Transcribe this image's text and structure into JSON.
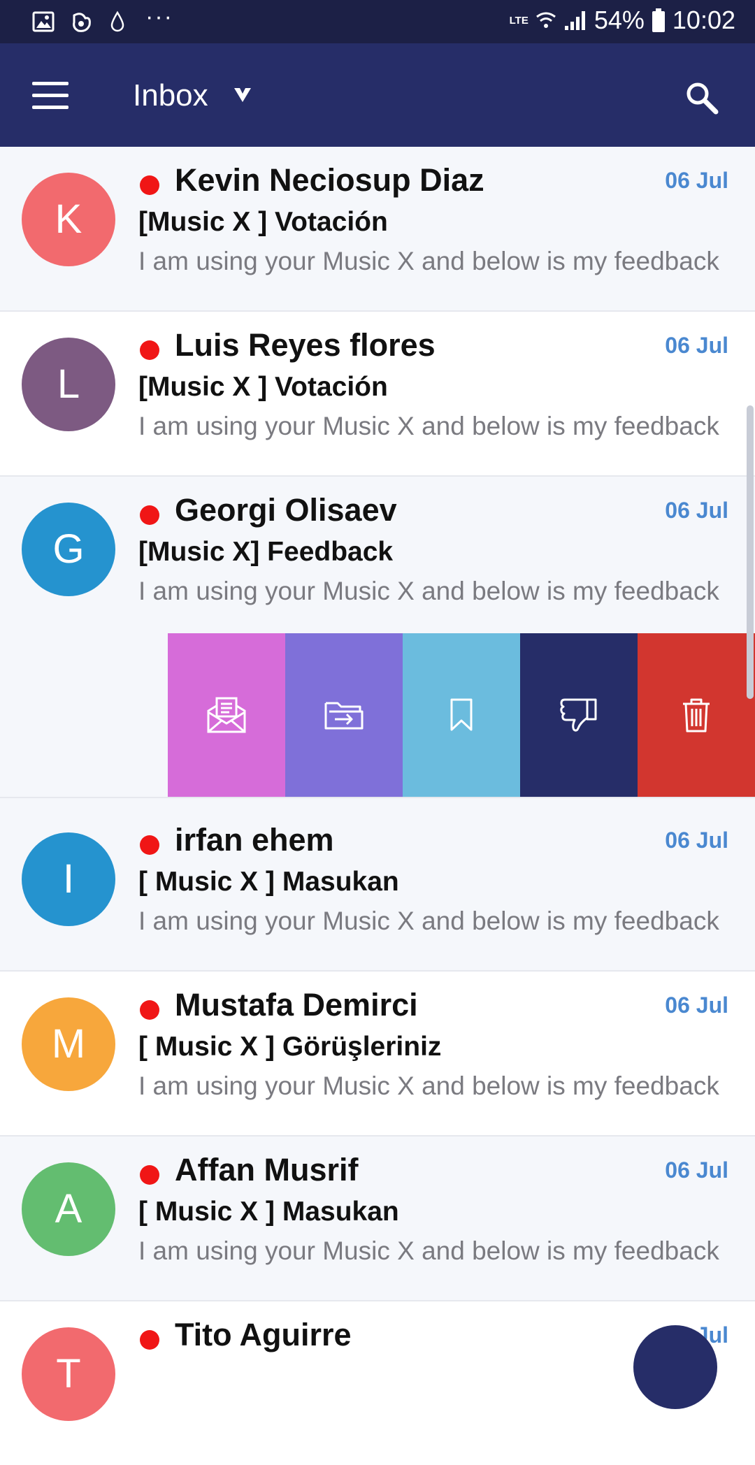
{
  "status_bar": {
    "battery": "54%",
    "time": "10:02",
    "network": "LTE",
    "left_icons": [
      "image-icon",
      "browser-icon",
      "drop-icon",
      "more-dots-icon"
    ]
  },
  "header": {
    "title": "Inbox",
    "menu_icon": "hamburger-menu-icon",
    "search_icon": "search-icon",
    "dropdown_icon": "chevron-down-icon"
  },
  "emails": [
    {
      "initial": "K",
      "sender": "Kevin Neciosup Diaz",
      "date": "06 Jul",
      "subject": "[Music X ] Votación",
      "preview": "I am using your Music X and below is my feedback",
      "avatar_color": "#f26a6e",
      "unread": true
    },
    {
      "initial": "L",
      "sender": "Luis Reyes flores",
      "date": "06 Jul",
      "subject": "[Music X ] Votación",
      "preview": "I am using your Music X and below is my feedback",
      "avatar_color": "#7d5a82",
      "unread": true
    },
    {
      "initial": "G",
      "sender": "Georgi Olisaev",
      "date": "06 Jul",
      "subject": "[Music X] Feedback",
      "preview": "I am using your Music X and below is my feedback",
      "avatar_color": "#2593cf",
      "unread": true
    },
    {
      "initial": "I",
      "sender": "irfan ehem",
      "date": "06 Jul",
      "subject": "[ Music X ] Masukan",
      "preview": "I am using your Music X and below is my feedback",
      "avatar_color": "#2593cf",
      "unread": true
    },
    {
      "initial": "M",
      "sender": "Mustafa Demirci",
      "date": "06 Jul",
      "subject": "[ Music X ] Görüşleriniz",
      "preview": "I am using your Music X and below is my feedback",
      "avatar_color": "#f7a73c",
      "unread": true
    },
    {
      "initial": "A",
      "sender": "Affan Musrif",
      "date": "06 Jul",
      "subject": "[ Music X ] Masukan",
      "preview": "I am using your Music X and below is my feedback",
      "avatar_color": "#63bd70",
      "unread": true
    },
    {
      "initial": "T",
      "sender": "Tito Aguirre",
      "date": "06 Jul",
      "subject": "",
      "preview": "",
      "avatar_color": "#f26a6e",
      "unread": true
    }
  ],
  "swipe_actions": [
    {
      "icon": "mark-read-envelope-icon",
      "color": "#d66cd9"
    },
    {
      "icon": "move-to-folder-icon",
      "color": "#7f70d9"
    },
    {
      "icon": "bookmark-icon",
      "color": "#6bbcde"
    },
    {
      "icon": "thumbs-down-icon",
      "color": "#262d68"
    },
    {
      "icon": "trash-icon",
      "color": "#d2362f"
    }
  ],
  "colors": {
    "status_bar": "#1c2046",
    "app_bar": "#262d68",
    "unread_dot": "#f01616",
    "date": "#4a88d0"
  }
}
